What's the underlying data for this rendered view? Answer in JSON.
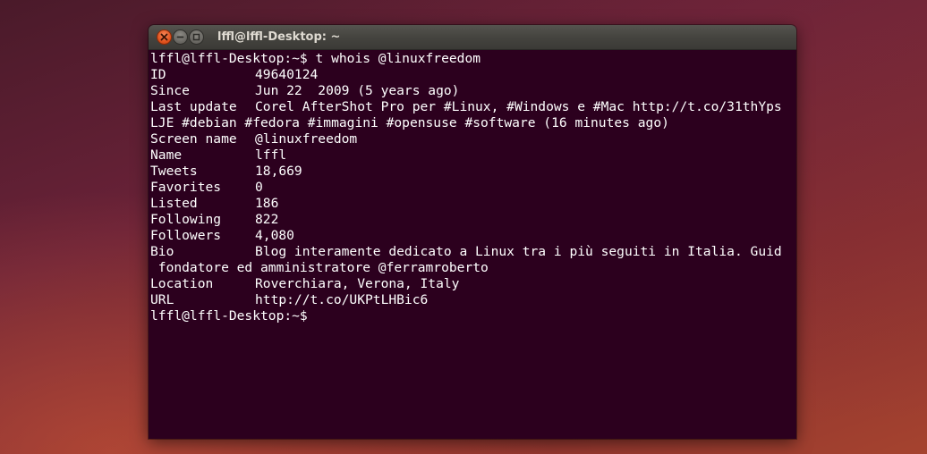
{
  "window": {
    "title": "lffl@lffl-Desktop: ~"
  },
  "icons": {
    "close": "close-icon",
    "minimize": "minimize-icon",
    "maximize": "maximize-icon"
  },
  "colors": {
    "terminal_bg": "#2c001e",
    "terminal_fg": "#ffffff",
    "close_button": "#e2541f"
  },
  "terminal": {
    "command_line": "lffl@lffl-Desktop:~$ t whois @linuxfreedom",
    "fields": [
      {
        "key": "ID",
        "value": "49640124"
      },
      {
        "key": "Since",
        "value": "Jun 22  2009 (5 years ago)"
      },
      {
        "key": "Last update",
        "value": "Corel AfterShot Pro per #Linux, #Windows e #Mac http://t.co/31thYps"
      }
    ],
    "last_update_cont": "LJE #debian #fedora #immagini #opensuse #software (16 minutes ago)",
    "fields2": [
      {
        "key": "Screen name",
        "value": "@linuxfreedom"
      },
      {
        "key": "Name",
        "value": "lffl"
      },
      {
        "key": "Tweets",
        "value": "18,669"
      },
      {
        "key": "Favorites",
        "value": "0"
      },
      {
        "key": "Listed",
        "value": "186"
      },
      {
        "key": "Following",
        "value": "822"
      },
      {
        "key": "Followers",
        "value": "4,080"
      },
      {
        "key": "Bio",
        "value": "Blog interamente dedicato a Linux tra i più seguiti in Italia. Guid"
      }
    ],
    "bio_cont": " fondatore ed amministratore @ferramroberto",
    "fields3": [
      {
        "key": "Location",
        "value": "Roverchiara, Verona, Italy"
      },
      {
        "key": "URL",
        "value": "http://t.co/UKPtLHBic6"
      }
    ],
    "prompt": "lffl@lffl-Desktop:~$"
  }
}
